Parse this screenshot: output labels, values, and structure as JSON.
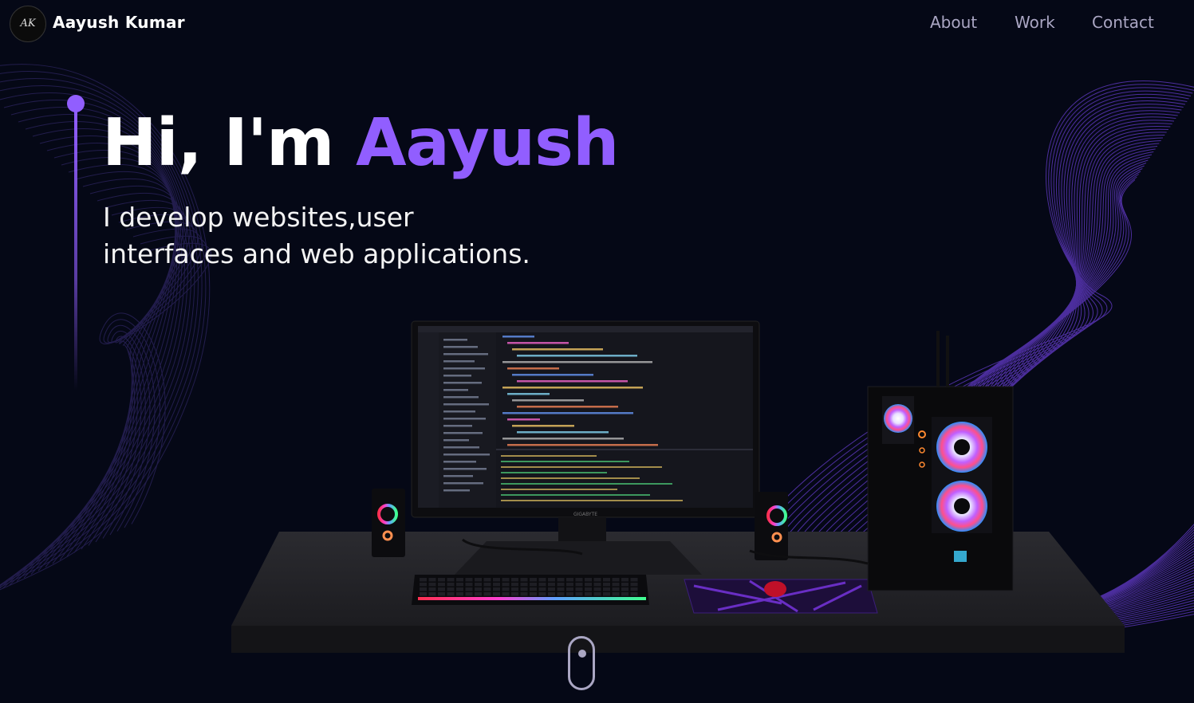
{
  "nav": {
    "logo_text": "AK",
    "brand": "Aayush Kumar",
    "links": [
      "About",
      "Work",
      "Contact"
    ]
  },
  "hero": {
    "greeting": "Hi, I'm",
    "name": "Aayush",
    "subtitle_line1": "I develop websites,user",
    "subtitle_line2": "interfaces and web applications."
  },
  "scene": {
    "monitor_brand": "GIGABYTE",
    "description_icon": "desk-setup-3d"
  },
  "colors": {
    "background": "#050816",
    "accent": "#915eff",
    "secondary_text": "#aaa6c3"
  }
}
